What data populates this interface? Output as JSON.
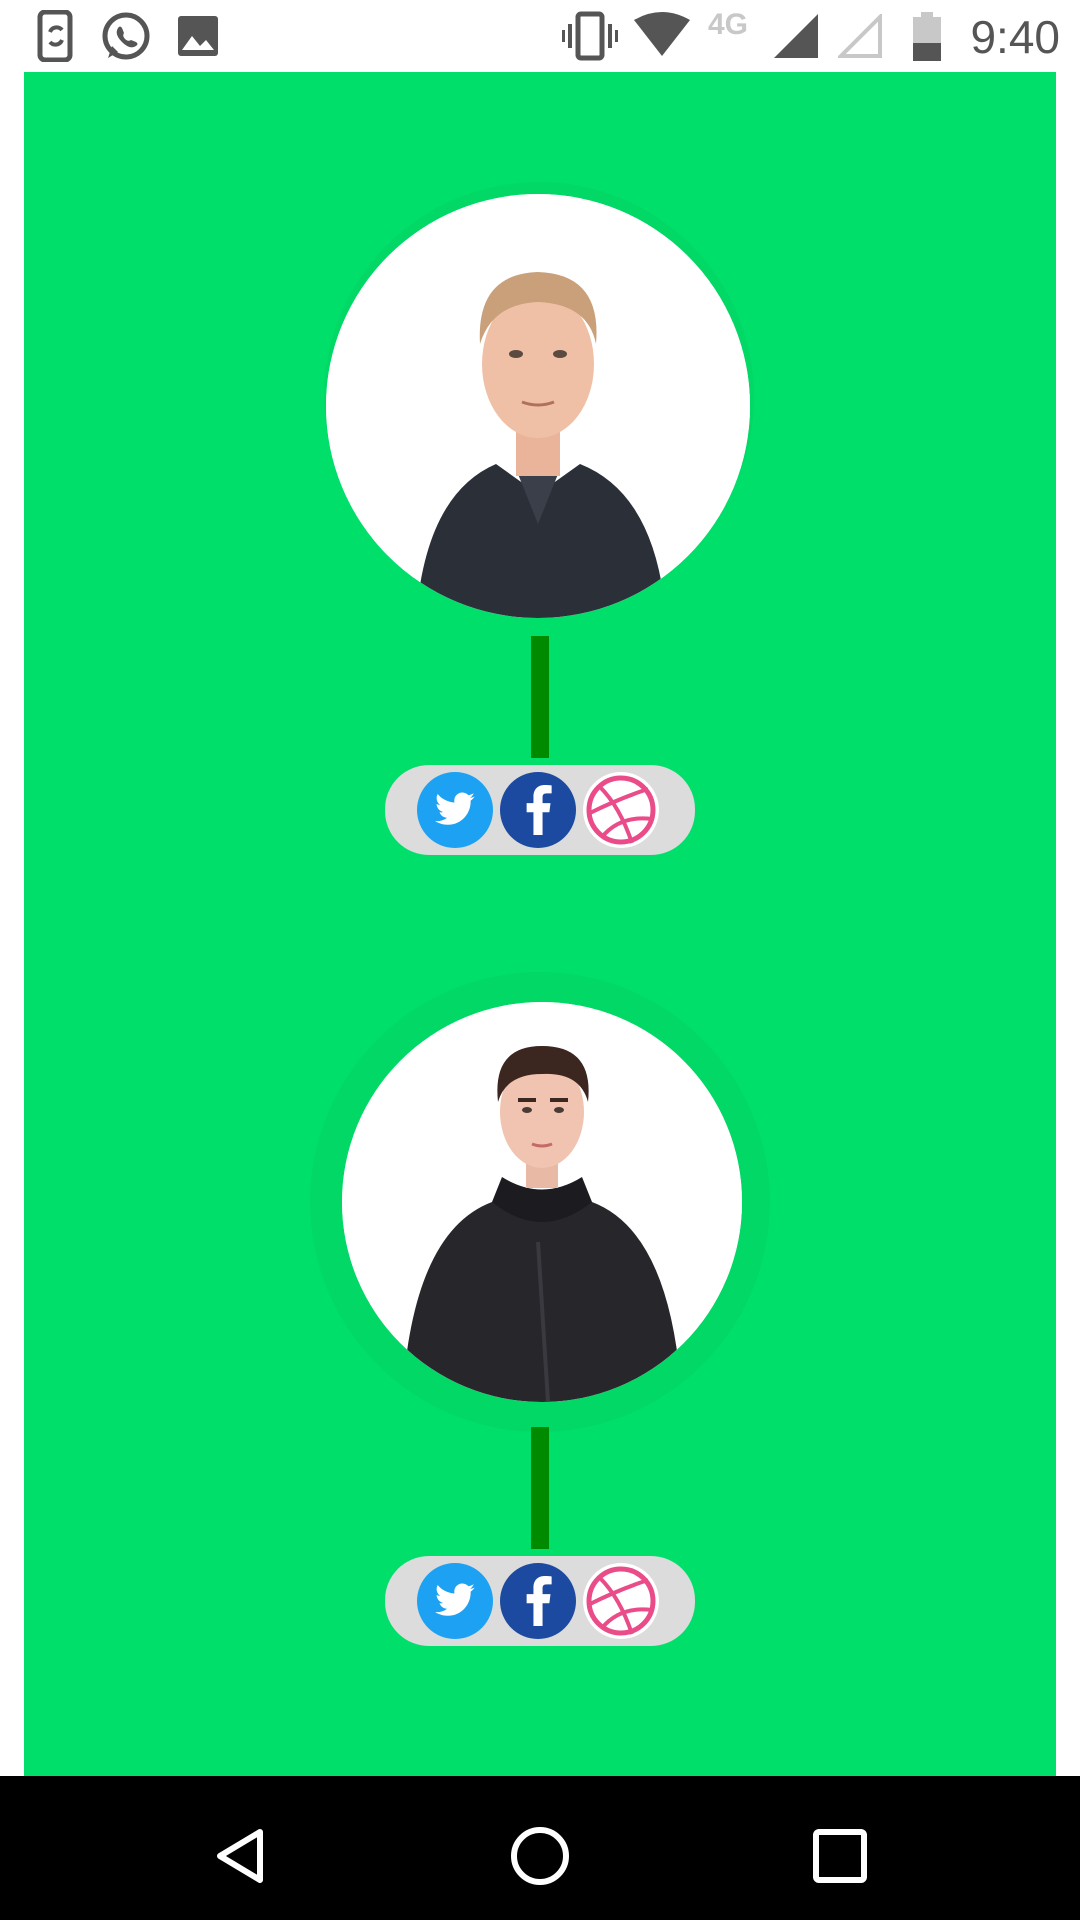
{
  "status_bar": {
    "time": "9:40",
    "network": "4G",
    "icons": [
      "phone-sync-icon",
      "whatsapp-icon",
      "image-icon",
      "vibrate-icon",
      "wifi-icon",
      "signal-icon",
      "signal-empty-icon",
      "battery-icon"
    ]
  },
  "colors": {
    "background_green": "#00df6a",
    "connector_green": "#008a00",
    "pill_grey": "#dcdcdc",
    "twitter_blue": "#1da1f2",
    "facebook_blue": "#1c4aa0",
    "dribbble_pink": "#ea4c89"
  },
  "profiles": [
    {
      "avatar_icon": "person-photo-icon",
      "social": [
        "twitter-icon",
        "facebook-icon",
        "dribbble-icon"
      ]
    },
    {
      "avatar_icon": "person-photo-icon",
      "social": [
        "twitter-icon",
        "facebook-icon",
        "dribbble-icon"
      ]
    }
  ],
  "navigation": [
    "back-icon",
    "home-icon",
    "recents-icon"
  ]
}
